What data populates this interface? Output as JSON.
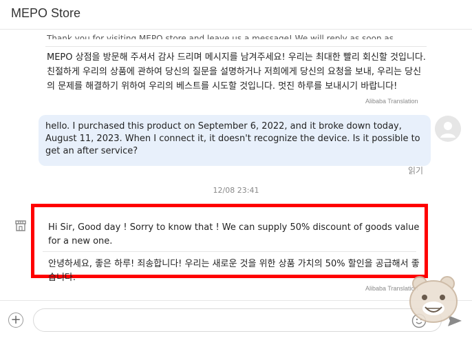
{
  "header": {
    "title": "MEPO Store"
  },
  "messages": {
    "store_prev": {
      "cut_text": "Thank you for visiting MEPO store and leave us a message! We will reply as soon as",
      "translation": "MEPO 상점을 방문해 주셔서 감사 드리며 메시지를 남겨주세요! 우리는 최대한 빨리 회신할 것입니다. 친절하게 우리의 상품에 관하여 당신의 질문을 설명하거나 저희에게 당신의 요청을 보내, 우리는 당신의 문제를 해결하기 위하여 우리의 베스트를 시도할 것입니다. 멋진 하루를 보내시기 바랍니다!",
      "translator": "Alibaba Translation"
    },
    "user": {
      "text": "hello. I purchased this product on September 6, 2022, and it broke down today, August 11, 2023. When I connect it, it doesn't recognize the device. Is it possible to get an after service?",
      "status": "읽기"
    },
    "timestamp": "12/08 23:41",
    "store_reply": {
      "english": "Hi Sir, Good day ! Sorry to know that ! We can supply 50% discount of goods value for a new one.",
      "korean": "안녕하세요, 좋은 하루! 죄송합니다! 우리는 새로운 것을 위한 상품 가치의 50% 할인을 공급해서 좋습니다.",
      "translator": "Alibaba Translation"
    }
  },
  "composer": {
    "placeholder": "",
    "value": ""
  },
  "icons": {
    "plus": "plus-icon",
    "emoji": "emoji-icon",
    "send": "send-icon",
    "store": "store-icon",
    "avatar": "user-avatar-icon"
  },
  "colors": {
    "user_bubble": "#e8f0fb",
    "highlight": "#ff0000"
  }
}
